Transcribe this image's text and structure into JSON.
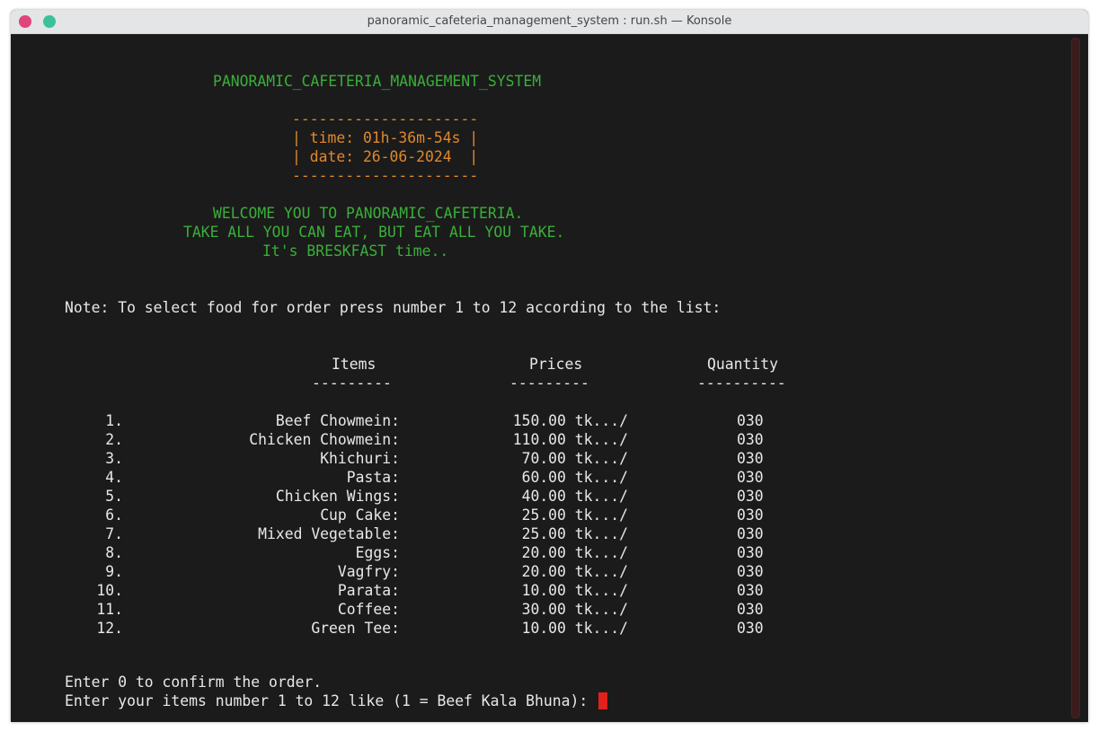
{
  "window": {
    "title": "panoramic_cafeteria_management_system : run.sh — Konsole"
  },
  "header": {
    "system_title": "PANORAMIC_CAFETERIA_MANAGEMENT_SYSTEM",
    "box_border": "---------------------",
    "time_line": "| time: 01h-36m-54s |",
    "date_line": "| date: 26-06-2024  |",
    "welcome": "WELCOME YOU TO PANORAMIC_CAFETERIA.",
    "motto": "TAKE ALL YOU CAN EAT, BUT EAT ALL YOU TAKE.",
    "meal_time": "It's BRESKFAST time.."
  },
  "note": "Note: To select food for order press number 1 to 12 according to the list:",
  "table": {
    "headers": {
      "items": "Items",
      "prices": "Prices",
      "quantity": "Quantity"
    },
    "underlines": {
      "items": "---------",
      "prices": "---------",
      "quantity": "----------"
    },
    "rows": [
      {
        "num": "1.",
        "item": "Beef Chowmein:",
        "price": "150.00 tk.../",
        "qty": "030"
      },
      {
        "num": "2.",
        "item": "Chicken Chowmein:",
        "price": "110.00 tk.../",
        "qty": "030"
      },
      {
        "num": "3.",
        "item": "Khichuri:",
        "price": "70.00 tk.../",
        "qty": "030"
      },
      {
        "num": "4.",
        "item": "Pasta:",
        "price": "60.00 tk.../",
        "qty": "030"
      },
      {
        "num": "5.",
        "item": "Chicken Wings:",
        "price": "40.00 tk.../",
        "qty": "030"
      },
      {
        "num": "6.",
        "item": "Cup Cake:",
        "price": "25.00 tk.../",
        "qty": "030"
      },
      {
        "num": "7.",
        "item": "Mixed Vegetable:",
        "price": "25.00 tk.../",
        "qty": "030"
      },
      {
        "num": "8.",
        "item": "Eggs:",
        "price": "20.00 tk.../",
        "qty": "030"
      },
      {
        "num": "9.",
        "item": "Vagfry:",
        "price": "20.00 tk.../",
        "qty": "030"
      },
      {
        "num": "10.",
        "item": "Parata:",
        "price": "10.00 tk.../",
        "qty": "030"
      },
      {
        "num": "11.",
        "item": "Coffee:",
        "price": "30.00 tk.../",
        "qty": "030"
      },
      {
        "num": "12.",
        "item": "Green Tee:",
        "price": "10.00 tk.../",
        "qty": "030"
      }
    ]
  },
  "footer": {
    "confirm_hint": "Enter 0 to confirm the order.",
    "prompt": "Enter your items number 1 to 12 like (1 = Beef Kala Bhuna): "
  },
  "colors": {
    "green_text": "#3aae3a",
    "orange_text": "#e0882d",
    "cursor": "#e0211c",
    "close_button": "#e0447c",
    "maximize_button": "#3bc199"
  }
}
